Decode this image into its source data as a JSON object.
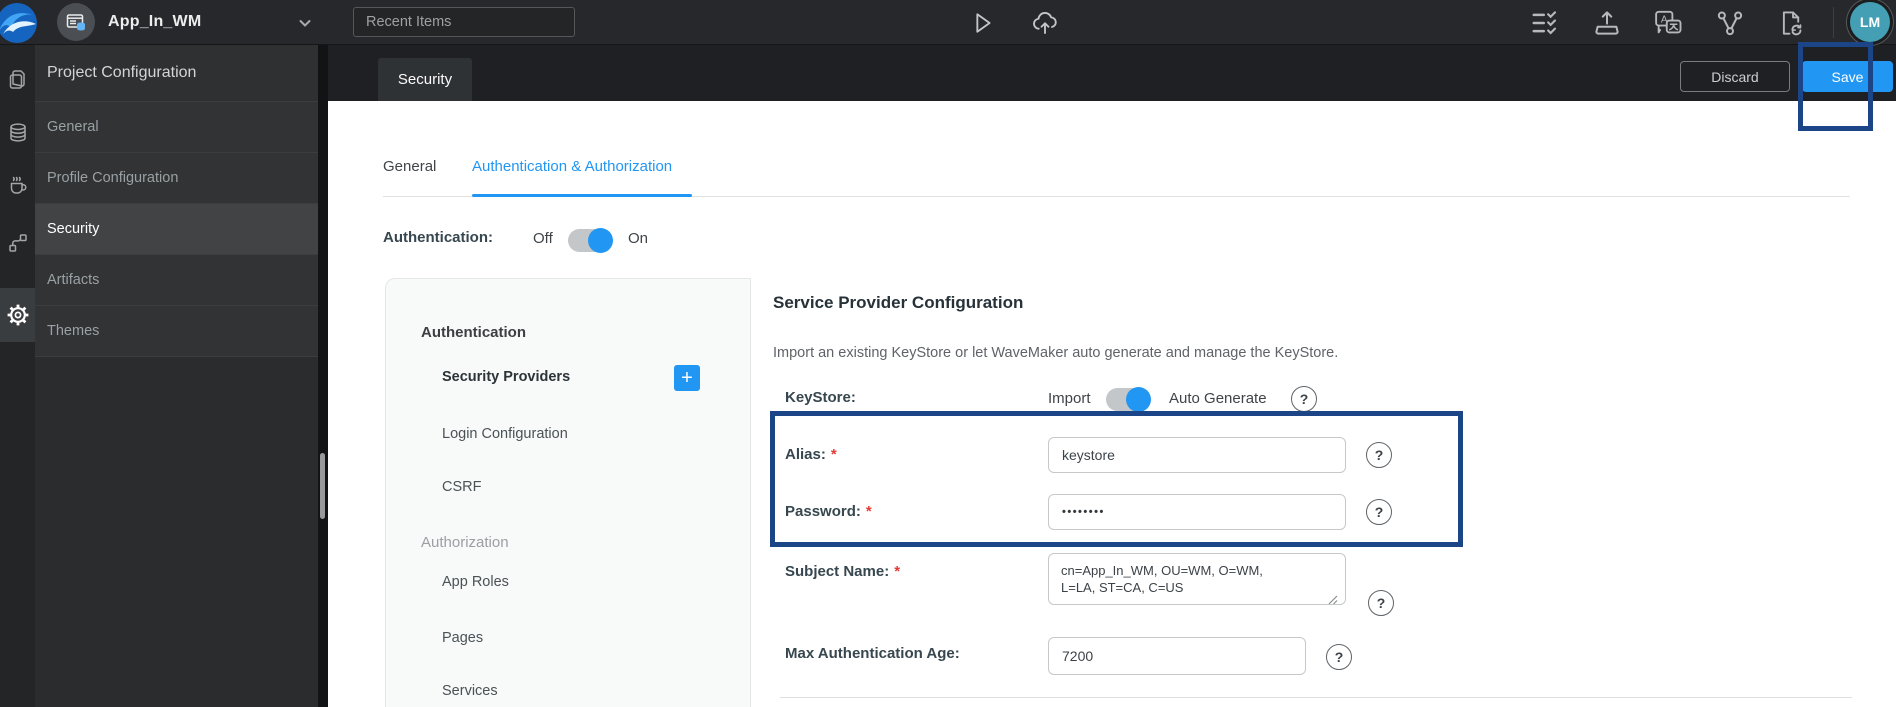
{
  "topbar": {
    "app_title": "App_In_WM",
    "recent_placeholder": "Recent Items",
    "avatar_initials": "LM"
  },
  "actions": {
    "discard_label": "Discard",
    "save_label": "Save"
  },
  "workspace_tab": "Security",
  "sidebar": {
    "header": "Project Configuration",
    "items": [
      {
        "label": "General"
      },
      {
        "label": "Profile Configuration"
      },
      {
        "label": "Security",
        "active": true
      },
      {
        "label": "Artifacts"
      },
      {
        "label": "Themes"
      }
    ]
  },
  "tabs": [
    {
      "label": "General"
    },
    {
      "label": "Authentication & Authorization",
      "active": true
    }
  ],
  "auth_toggle": {
    "label": "Authentication:",
    "off_label": "Off",
    "on_label": "On",
    "state": "On"
  },
  "security_menu": {
    "sections": [
      {
        "title": "Authentication",
        "items": [
          {
            "label": "Security Providers",
            "selected": true,
            "add_button": "+"
          },
          {
            "label": "Login Configuration"
          },
          {
            "label": "CSRF"
          }
        ]
      },
      {
        "title": "Authorization",
        "items": [
          {
            "label": "App Roles"
          },
          {
            "label": "Pages"
          },
          {
            "label": "Services"
          }
        ]
      }
    ]
  },
  "provider_form": {
    "title": "Service Provider Configuration",
    "description": "Import an existing KeyStore or let WaveMaker auto generate and manage the KeyStore.",
    "required_marker": "*",
    "help_glyph": "?",
    "keystore": {
      "label": "KeyStore:",
      "left_option": "Import",
      "right_option": "Auto Generate",
      "state": "Auto Generate"
    },
    "fields": {
      "alias": {
        "label": "Alias:",
        "required": true,
        "value": "keystore"
      },
      "password": {
        "label": "Password:",
        "required": true,
        "value": "••••••••"
      },
      "subject_name": {
        "label": "Subject Name:",
        "required": true,
        "value": "cn=App_In_WM, OU=WM, O=WM, L=LA, ST=CA, C=US"
      },
      "max_auth_age": {
        "label": "Max Authentication Age:",
        "value": "7200"
      }
    }
  },
  "colors": {
    "accent": "#2196f3",
    "annotation_box": "#1c4587",
    "avatar": "#459fb4"
  }
}
